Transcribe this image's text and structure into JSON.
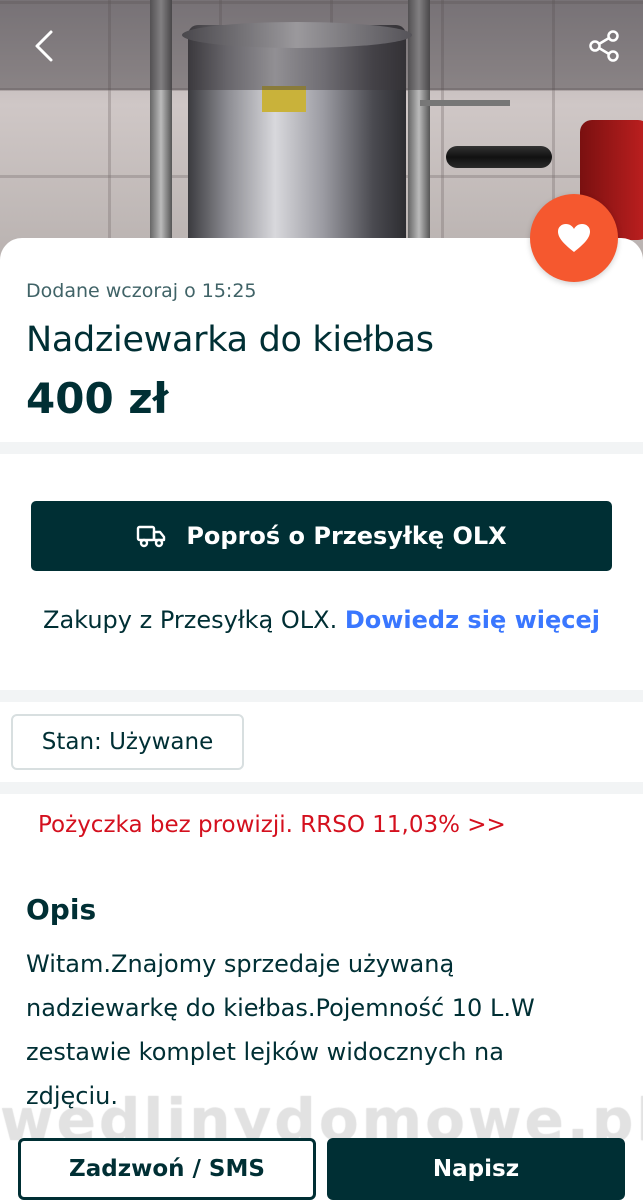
{
  "header": {
    "back_icon": "chevron-left-icon",
    "share_icon": "share-icon"
  },
  "favorite": {
    "icon": "heart-icon",
    "color": "#f5582f"
  },
  "listing": {
    "added": "Dodane wczoraj o 15:25",
    "title": "Nadziewarka do kiełbas",
    "price": "400 zł"
  },
  "shipping": {
    "button_label": "Poproś o Przesyłkę OLX",
    "button_icon": "truck-icon",
    "info_text": "Zakupy z Przesyłką OLX.",
    "info_link": "Dowiedz się więcej",
    "link_color": "#3a77ff"
  },
  "condition": {
    "label": "Stan: Używane"
  },
  "loan": {
    "text": "Pożyczka bez prowizji. RRSO 11,03% >>",
    "color": "#d4101e"
  },
  "description": {
    "heading": "Opis",
    "lines": [
      "Witam.Znajomy sprzedaje używaną",
      "nadziewarkę do kiełbas.Pojemność 10 L.W",
      "zestawie komplet lejków widocznych na",
      "zdjęciu."
    ]
  },
  "watermark": "wedlinydomowe.pl",
  "actions": {
    "call_label": "Zadzwoń / SMS",
    "message_label": "Napisz"
  },
  "colors": {
    "primary": "#002f34",
    "accent": "#f5582f"
  }
}
